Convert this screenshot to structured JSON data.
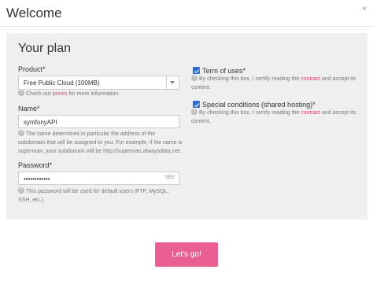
{
  "header": {
    "title": "Welcome",
    "close_glyph": "×"
  },
  "plan": {
    "title": "Your plan",
    "product": {
      "label": "Product*",
      "selected": "Free Public Cloud (100MB)",
      "help_prefix": "Check our ",
      "help_link": "prices",
      "help_suffix": " for more information."
    },
    "name": {
      "label": "Name*",
      "value": "symfonyAPI",
      "help": "The name determines in particular the address of the subdomain that will be assigned to you. For example, if the name is superman, your subdomain will be http://superman.alwaysdata.net."
    },
    "password": {
      "label": "Password*",
      "value": "••••••••••••",
      "see_label": "SEE",
      "help": "This password will be used for default users (FTP, MySQL, SSH, etc.)."
    },
    "terms": {
      "label": "Term of uses*",
      "checked": true,
      "help_prefix": "By checking this box, I certify reading the ",
      "help_link": "contract",
      "help_suffix": " and accept its content."
    },
    "special": {
      "label": "Special conditions (shared hosting)*",
      "checked": true,
      "help_prefix": "By checking this box, I certify reading the ",
      "help_link": "contract",
      "help_suffix": " and accept its content."
    }
  },
  "cta": {
    "label": "Let's go!"
  },
  "icons": {
    "help": "?",
    "dropdown": "chevron-down-icon",
    "check": "check-icon",
    "close": "close-icon"
  },
  "colors": {
    "accent": "#ea5f93",
    "link": "#d04a74",
    "checkbox": "#2f6fd1",
    "panel": "#efefef"
  }
}
